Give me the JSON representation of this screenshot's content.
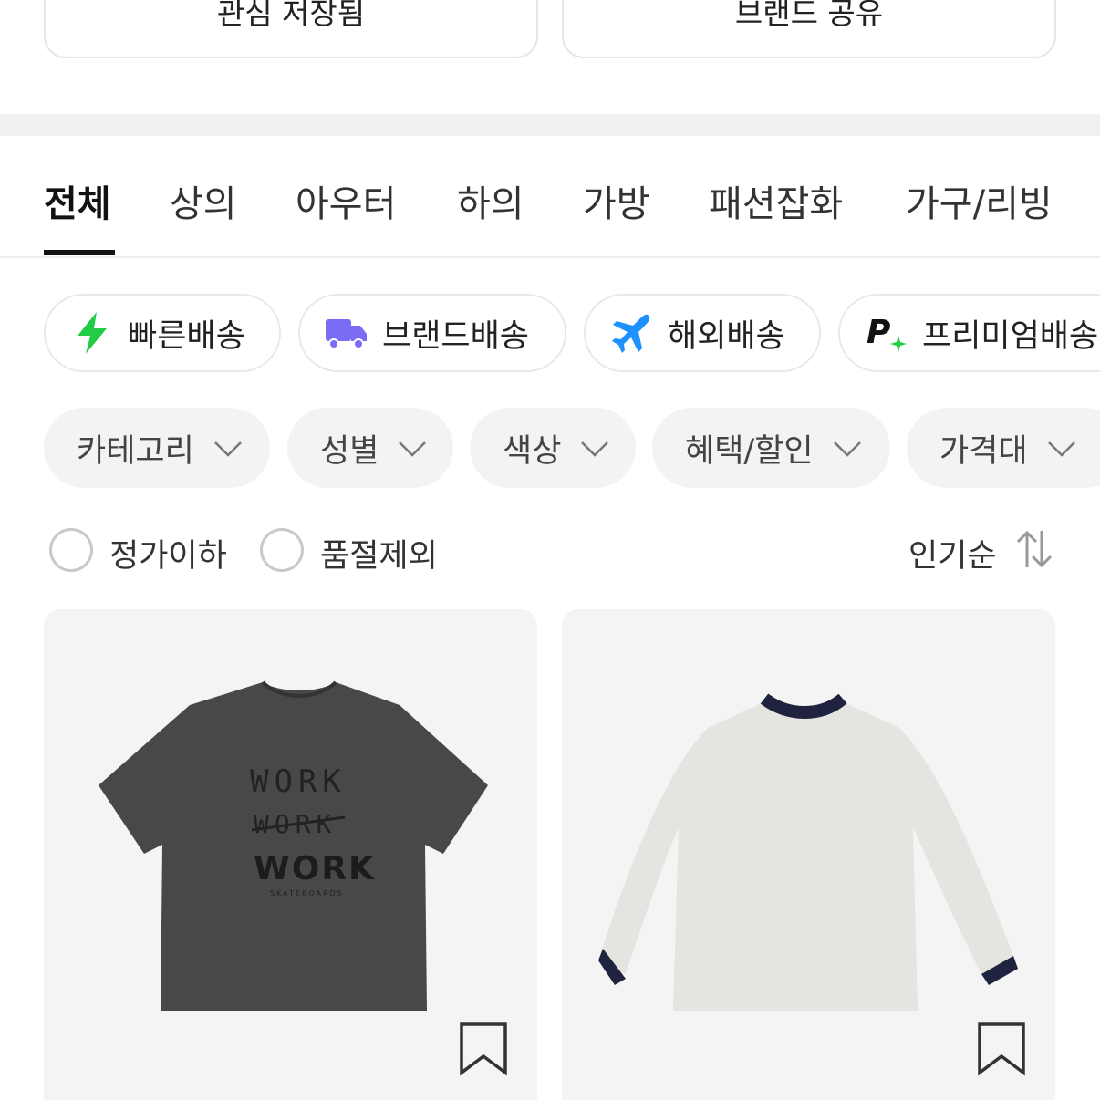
{
  "actions": {
    "wishlist_saved": "관심 저장됨",
    "share_brand": "브랜드 공유"
  },
  "tabs": [
    {
      "label": "전체",
      "active": true
    },
    {
      "label": "상의",
      "active": false
    },
    {
      "label": "아우터",
      "active": false
    },
    {
      "label": "하의",
      "active": false
    },
    {
      "label": "가방",
      "active": false
    },
    {
      "label": "패션잡화",
      "active": false
    },
    {
      "label": "가구/리빙",
      "active": false
    }
  ],
  "delivery": [
    {
      "label": "빠른배송",
      "icon": "lightning-icon",
      "color": "#22cc44"
    },
    {
      "label": "브랜드배송",
      "icon": "truck-icon",
      "color": "#7b6cf6"
    },
    {
      "label": "해외배송",
      "icon": "airplane-icon",
      "color": "#1e90ff"
    },
    {
      "label": "프리미엄배송",
      "icon": "premium-p-icon",
      "color": "#111111"
    }
  ],
  "filters": [
    {
      "label": "카테고리"
    },
    {
      "label": "성별"
    },
    {
      "label": "색상"
    },
    {
      "label": "혜택/할인"
    },
    {
      "label": "가격대"
    }
  ],
  "options": {
    "below_list_price": "정가이하",
    "exclude_sold_out": "품절제외",
    "sort": "인기순"
  },
  "products": [
    {
      "name": "charcoal-work-graphic-tshirt",
      "shirt_color": "#4a4847"
    },
    {
      "name": "oatmeal-ringer-longsleeve",
      "shirt_color": "#e6e4e0"
    }
  ]
}
